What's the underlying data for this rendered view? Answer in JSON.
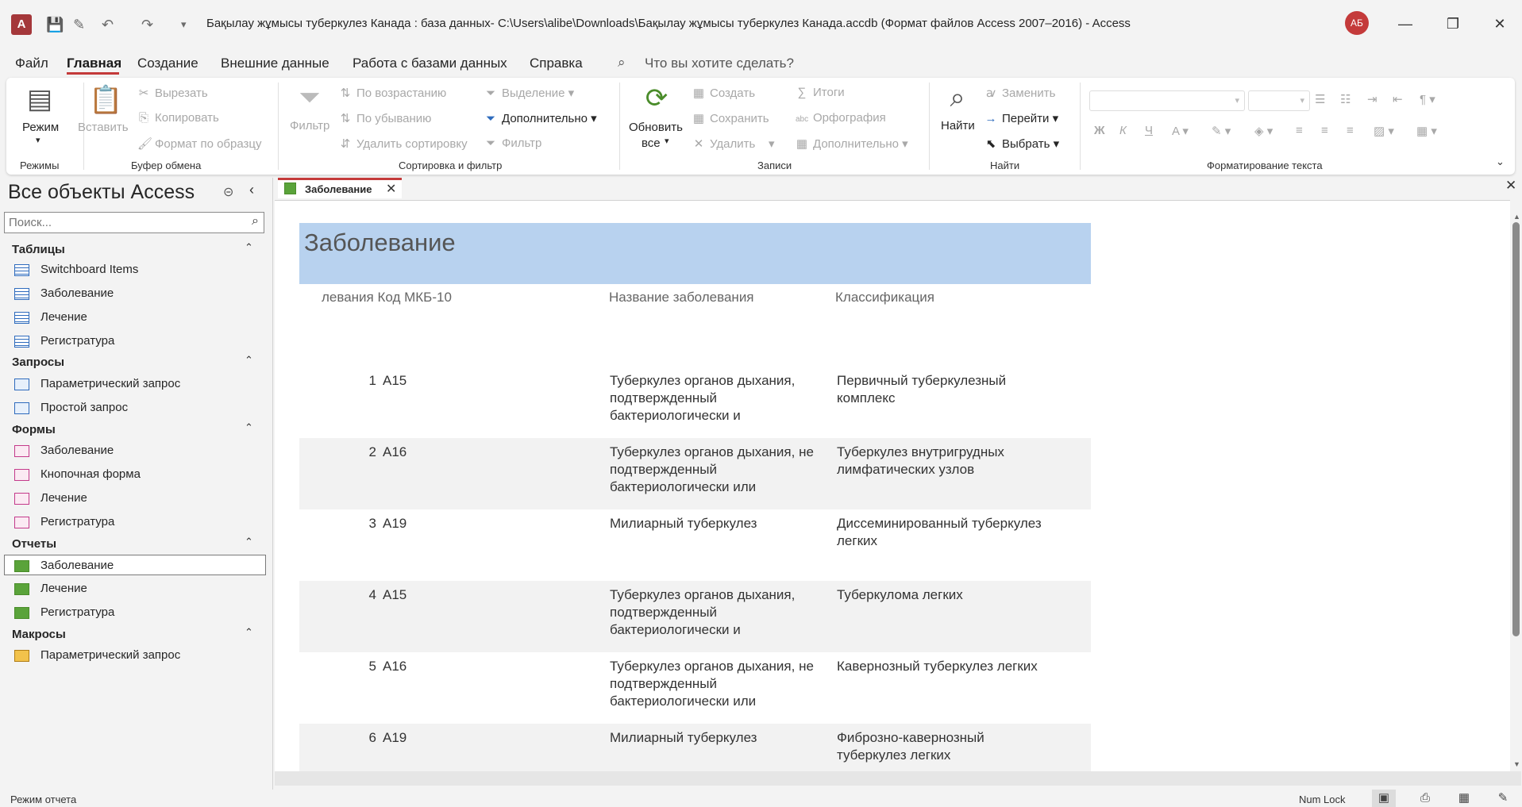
{
  "window": {
    "title": "Бақылау жұмысы туберкулез Канада : база данных- C:\\Users\\alibe\\Downloads\\Бақылау жұмысы туберкулез Канада.accdb (Формат файлов Access 2007–2016)  -  Access",
    "app_logo": "A",
    "user_initials": "АБ"
  },
  "menu": {
    "items": [
      "Файл",
      "Главная",
      "Создание",
      "Внешние данные",
      "Работа с базами данных",
      "Справка"
    ],
    "active": "Главная",
    "search_placeholder": "Что вы хотите сделать?"
  },
  "ribbon": {
    "modes": {
      "view_label": "Режим",
      "group": "Режимы"
    },
    "clipboard": {
      "paste": "Вставить",
      "cut": "Вырезать",
      "copy": "Копировать",
      "format_painter": "Формат по образцу",
      "group": "Буфер обмена"
    },
    "sort_filter": {
      "filter": "Фильтр",
      "ascending": "По возрастанию",
      "descending": "По убыванию",
      "remove_sort": "Удалить сортировку",
      "selection": "Выделение",
      "advanced": "Дополнительно",
      "toggle_filter": "Фильтр",
      "group": "Сортировка и фильтр"
    },
    "records": {
      "refresh_line1": "Обновить",
      "refresh_line2": "все",
      "new": "Создать",
      "save": "Сохранить",
      "delete": "Удалить",
      "totals": "Итоги",
      "spelling": "Орфография",
      "more": "Дополнительно",
      "group": "Записи"
    },
    "find": {
      "find": "Найти",
      "replace": "Заменить",
      "goto": "Перейти",
      "select": "Выбрать",
      "group": "Найти"
    },
    "text_format": {
      "bold": "Ж",
      "italic": "К",
      "underline": "Ч",
      "group": "Форматирование текста"
    }
  },
  "nav_pane": {
    "title": "Все объекты Access",
    "search_placeholder": "Поиск...",
    "sections": [
      {
        "name": "Таблицы",
        "items": [
          "Switchboard Items",
          "Заболевание",
          "Лечение",
          "Регистратура"
        ]
      },
      {
        "name": "Запросы",
        "items": [
          "Параметрический запрос",
          "Простой запрос"
        ]
      },
      {
        "name": "Формы",
        "items": [
          "Заболевание",
          "Кнопочная форма",
          "Лечение",
          "Регистратура"
        ]
      },
      {
        "name": "Отчеты",
        "items": [
          "Заболевание",
          "Лечение",
          "Регистратура"
        ]
      },
      {
        "name": "Макросы",
        "items": [
          "Параметрический запрос"
        ]
      }
    ]
  },
  "document_tab": {
    "label": "Заболевание"
  },
  "report": {
    "title": "Заболевание",
    "columns": [
      "левания Код МКБ-10",
      "Название заболевания",
      "Классификация"
    ],
    "rows": [
      {
        "num": "1",
        "code": "A15",
        "name": "Туберкулез органов дыхания, подтвержденный бактериологически и",
        "class": "Первичный туберкулезный комплекс"
      },
      {
        "num": "2",
        "code": "A16",
        "name": "Туберкулез органов дыхания, не подтвержденный бактериологически или",
        "class": "Туберкулез внутригрудных лимфатических узлов"
      },
      {
        "num": "3",
        "code": "A19",
        "name": "Милиарный туберкулез",
        "class": "Диссеминированный туберкулез легких"
      },
      {
        "num": "4",
        "code": "A15",
        "name": "Туберкулез органов дыхания, подтвержденный бактериологически и",
        "class": "Туберкулома легких"
      },
      {
        "num": "5",
        "code": "A16",
        "name": "Туберкулез органов дыхания, не подтвержденный бактериологически или",
        "class": "Кавернозный туберкулез легких"
      },
      {
        "num": "6",
        "code": "A19",
        "name": "Милиарный туберкулез",
        "class": "Фиброзно-кавернозный туберкулез легких"
      }
    ]
  },
  "status": {
    "mode": "Режим отчета",
    "numlock": "Num Lock"
  }
}
